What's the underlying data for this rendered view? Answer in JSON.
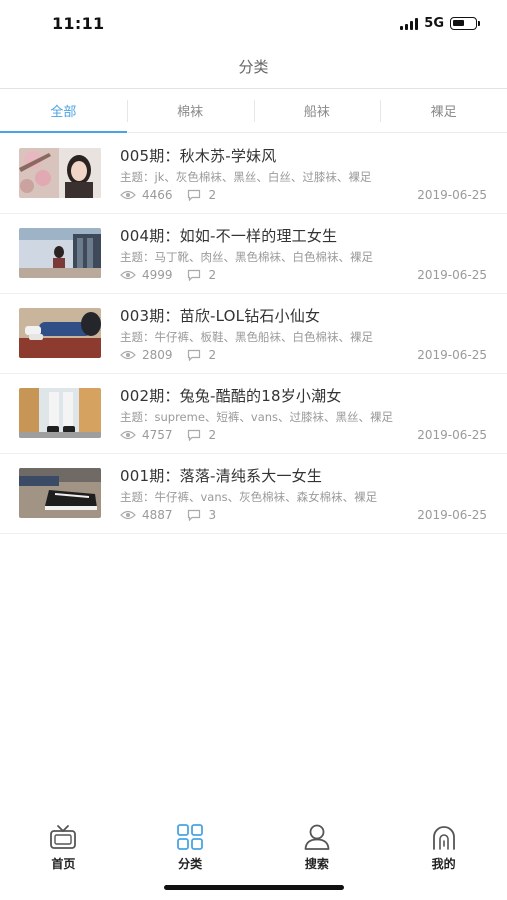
{
  "status_bar": {
    "time": "11:11",
    "network": "5G",
    "battery_level": 0.55
  },
  "nav": {
    "title": "分类"
  },
  "tabs": [
    {
      "label": "全部",
      "active": true
    },
    {
      "label": "棉袜",
      "active": false
    },
    {
      "label": "船袜",
      "active": false
    },
    {
      "label": "裸足",
      "active": false
    }
  ],
  "articles": [
    {
      "title": "005期：秋木苏-学妹风",
      "tags": "主题：jk、灰色棉袜、黑丝、白丝、过膝袜、裸足",
      "views": "4466",
      "comments": "2",
      "date": "2019-06-25"
    },
    {
      "title": "004期：如如-不一样的理工女生",
      "tags": "主题：马丁靴、肉丝、黑色棉袜、白色棉袜、裸足",
      "views": "4999",
      "comments": "2",
      "date": "2019-06-25"
    },
    {
      "title": "003期：苗欣-LOL钻石小仙女",
      "tags": "主题：牛仔裤、板鞋、黑色船袜、白色棉袜、裸足",
      "views": "2809",
      "comments": "2",
      "date": "2019-06-25"
    },
    {
      "title": "002期：兔兔-酷酷的18岁小潮女",
      "tags": "主题：supreme、短裤、vans、过膝袜、黑丝、裸足",
      "views": "4757",
      "comments": "2",
      "date": "2019-06-25"
    },
    {
      "title": "001期：落落-清纯系大一女生",
      "tags": "主题：牛仔裤、vans、灰色棉袜、森女棉袜、裸足",
      "views": "4887",
      "comments": "3",
      "date": "2019-06-25"
    }
  ],
  "bottom_tabs": [
    {
      "label": "首页",
      "icon": "tv-icon"
    },
    {
      "label": "分类",
      "icon": "grid-icon",
      "active": true
    },
    {
      "label": "搜索",
      "icon": "person-icon"
    },
    {
      "label": "我的",
      "icon": "profile-icon"
    }
  ],
  "colors": {
    "accent": "#4aa3e3",
    "text": "#333333",
    "muted": "#9a9a9a"
  }
}
